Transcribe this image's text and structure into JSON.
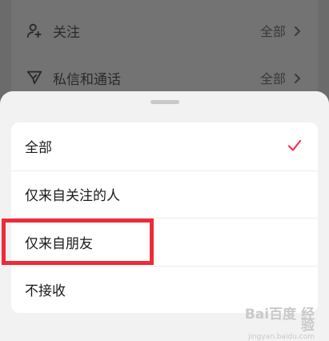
{
  "background_list": {
    "items": [
      {
        "label": "关注",
        "value": "全部",
        "icon": "user-plus-icon"
      },
      {
        "label": "私信和通话",
        "value": "全部",
        "icon": "send-icon"
      }
    ]
  },
  "sheet": {
    "options": [
      {
        "label": "全部",
        "selected": true
      },
      {
        "label": "仅来自关注的人",
        "selected": false
      },
      {
        "label": "仅来自朋友",
        "selected": false
      },
      {
        "label": "不接收",
        "selected": false
      }
    ],
    "check_color": "#fe2c55"
  },
  "annotation": {
    "color": "#ee2b38",
    "target": "仅来自朋友"
  },
  "watermark": {
    "brand": "Bai百度 经验",
    "sub": "jingyan.baidu.com"
  }
}
